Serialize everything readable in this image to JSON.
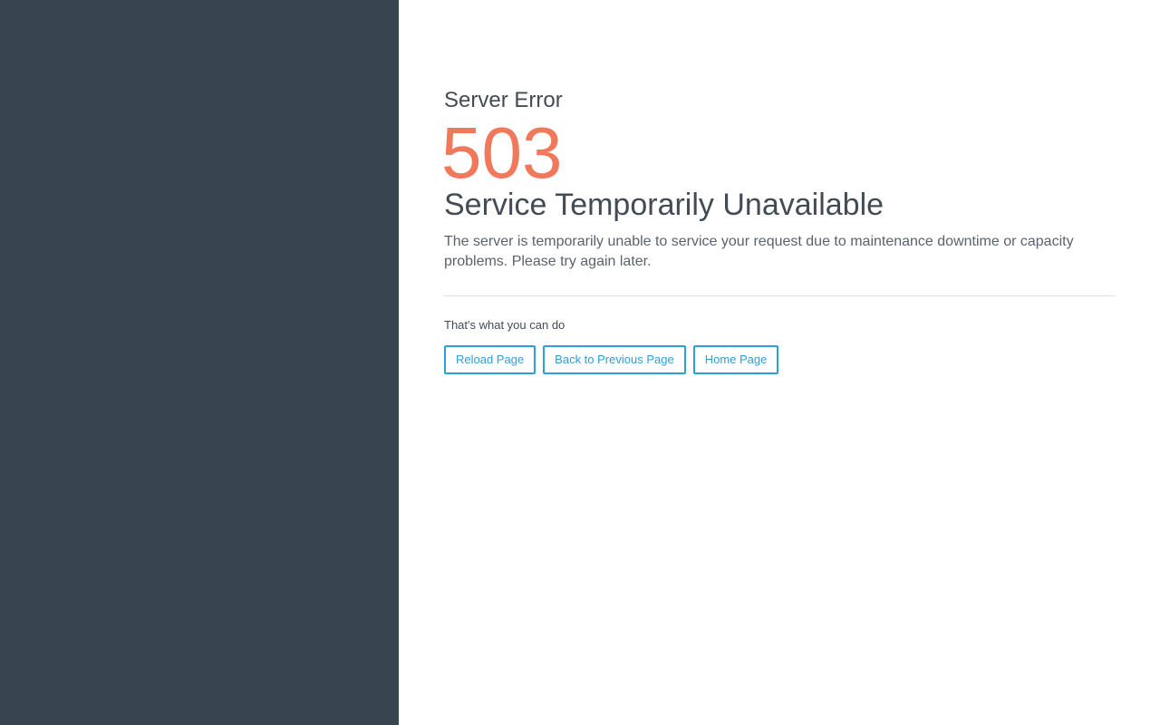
{
  "page": {
    "sidebar_color": "#38444f",
    "accent_color": "#f1785a",
    "link_color": "#2e9fd8"
  },
  "error": {
    "label": "Server Error",
    "code": "503",
    "title": "Service Temporarily Unavailable",
    "description": "The server is temporarily unable to service your request due to maintenance downtime or capacity problems. Please try again later."
  },
  "options": {
    "label": "That's what you can do",
    "buttons": [
      {
        "label": "Reload Page"
      },
      {
        "label": "Back to Previous Page"
      },
      {
        "label": "Home Page"
      }
    ]
  }
}
